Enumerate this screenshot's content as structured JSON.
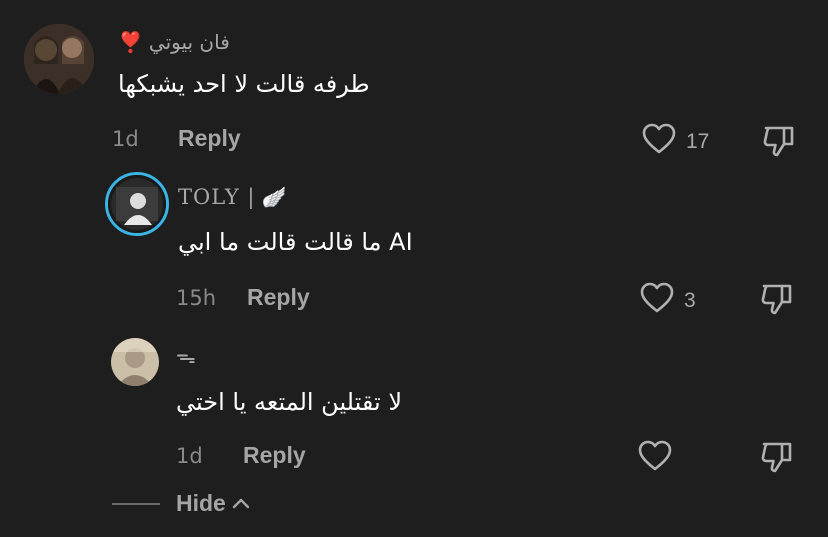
{
  "comments": [
    {
      "username": "فان بيوتي",
      "username_emoji": "❣️",
      "text": "طرفه قالت لا احد يشبكها",
      "time": "1d",
      "reply_label": "Reply",
      "likes": "17"
    },
    {
      "username": "TOLY |",
      "username_emoji": "🪽",
      "text": "ما قالت قالت ما ابي AI",
      "time": "15h",
      "reply_label": "Reply",
      "likes": "3"
    },
    {
      "username": "ᯓ",
      "username_emoji": "",
      "text": "لا تقتلين المتعه يا اختي",
      "time": "1d",
      "reply_label": "Reply",
      "likes": ""
    }
  ],
  "hide_label": "Hide",
  "icons": {
    "like": "heart-outline-icon",
    "dislike": "thumbs-down-icon",
    "hide": "chevron-up-icon"
  },
  "colors": {
    "background": "#1e1e1e",
    "avatar_ring": "#3bb4e6"
  }
}
